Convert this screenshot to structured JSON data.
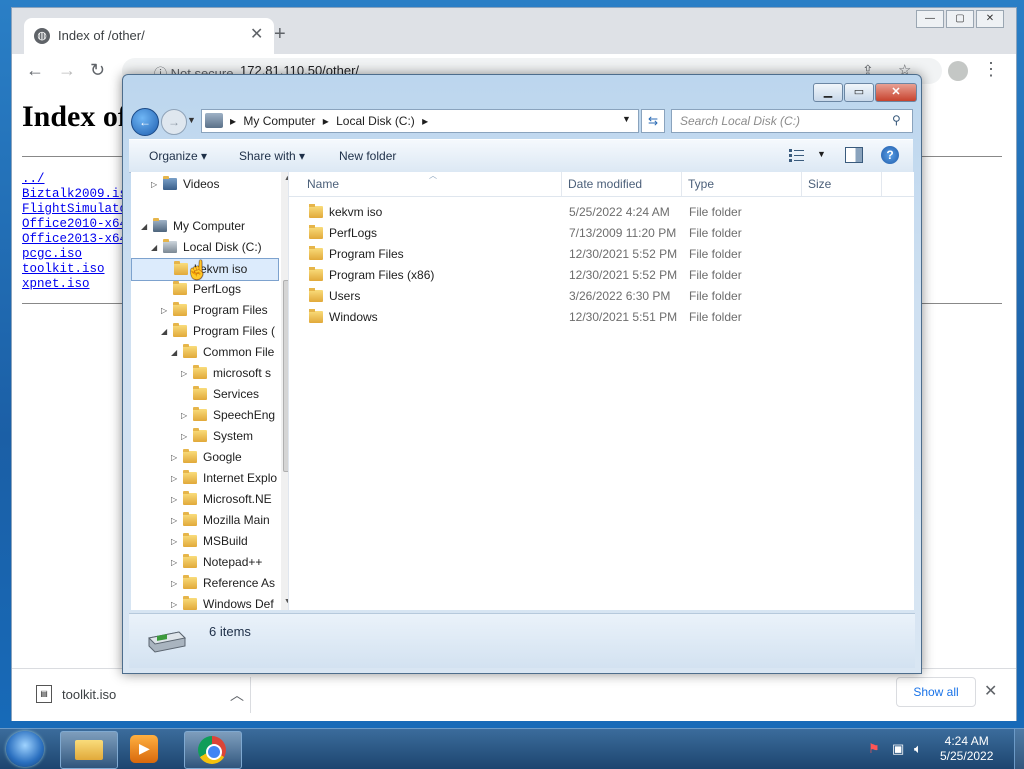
{
  "chrome": {
    "tab_title": "Index of /other/",
    "tab_close": "✕",
    "new_tab": "+",
    "omnibox_secure": "ⓘ Not secure",
    "omnibox_url": "172.81.110.50/other/",
    "window_minimize": "—",
    "window_maximize": "▢",
    "window_close": "✕"
  },
  "page": {
    "heading": "Index of /other/",
    "links": [
      "../",
      "Biztalk2009.iso",
      "FlightSimulator.iso",
      "Office2010-x64.iso",
      "Office2013-x64.iso",
      "pcgc.iso",
      "toolkit.iso",
      "xpnet.iso"
    ]
  },
  "downloads": {
    "file_name": "toolkit.iso",
    "show_all": "Show all",
    "chevron": "︿",
    "close": "✕"
  },
  "explorer": {
    "breadcrumbs": [
      "My Computer",
      "Local Disk (C:)"
    ],
    "search_placeholder": "Search Local Disk (C:)",
    "commands": {
      "organize": "Organize ▾",
      "share": "Share with ▾",
      "new_folder": "New folder"
    },
    "nav_tree": [
      {
        "label": "Videos",
        "indent": 1,
        "arrow": "▷",
        "icon": "video"
      },
      {
        "label": "My Computer",
        "indent": 0,
        "arrow": "◢",
        "icon": "computer"
      },
      {
        "label": "Local Disk (C:)",
        "indent": 1,
        "arrow": "◢",
        "icon": "drive"
      },
      {
        "label": "kekvm iso",
        "indent": 2,
        "arrow": "",
        "icon": "folder",
        "selected": true
      },
      {
        "label": "PerfLogs",
        "indent": 2,
        "arrow": "",
        "icon": "folder"
      },
      {
        "label": "Program Files",
        "indent": 2,
        "arrow": "▷",
        "icon": "folder"
      },
      {
        "label": "Program Files (",
        "indent": 2,
        "arrow": "◢",
        "icon": "folder"
      },
      {
        "label": "Common File",
        "indent": 3,
        "arrow": "◢",
        "icon": "folder"
      },
      {
        "label": "microsoft s",
        "indent": 4,
        "arrow": "▷",
        "icon": "folder"
      },
      {
        "label": "Services",
        "indent": 4,
        "arrow": "",
        "icon": "folder"
      },
      {
        "label": "SpeechEng",
        "indent": 4,
        "arrow": "▷",
        "icon": "folder"
      },
      {
        "label": "System",
        "indent": 4,
        "arrow": "▷",
        "icon": "folder"
      },
      {
        "label": "Google",
        "indent": 3,
        "arrow": "▷",
        "icon": "folder"
      },
      {
        "label": "Internet Explo",
        "indent": 3,
        "arrow": "▷",
        "icon": "folder"
      },
      {
        "label": "Microsoft.NE",
        "indent": 3,
        "arrow": "▷",
        "icon": "folder"
      },
      {
        "label": "Mozilla Main",
        "indent": 3,
        "arrow": "▷",
        "icon": "folder"
      },
      {
        "label": "MSBuild",
        "indent": 3,
        "arrow": "▷",
        "icon": "folder"
      },
      {
        "label": "Notepad++",
        "indent": 3,
        "arrow": "▷",
        "icon": "folder"
      },
      {
        "label": "Reference As",
        "indent": 3,
        "arrow": "▷",
        "icon": "folder"
      },
      {
        "label": "Windows Def",
        "indent": 3,
        "arrow": "▷",
        "icon": "folder"
      }
    ],
    "columns": [
      "Name",
      "Date modified",
      "Type",
      "Size"
    ],
    "files": [
      {
        "name": "kekvm iso",
        "date": "5/25/2022 4:24 AM",
        "type": "File folder",
        "size": ""
      },
      {
        "name": "PerfLogs",
        "date": "7/13/2009 11:20 PM",
        "type": "File folder",
        "size": ""
      },
      {
        "name": "Program Files",
        "date": "12/30/2021 5:52 PM",
        "type": "File folder",
        "size": ""
      },
      {
        "name": "Program Files (x86)",
        "date": "12/30/2021 5:52 PM",
        "type": "File folder",
        "size": ""
      },
      {
        "name": "Users",
        "date": "3/26/2022 6:30 PM",
        "type": "File folder",
        "size": ""
      },
      {
        "name": "Windows",
        "date": "12/30/2021 5:51 PM",
        "type": "File folder",
        "size": ""
      }
    ],
    "item_count": "6 items"
  },
  "taskbar": {
    "time": "4:24 AM",
    "date": "5/25/2022"
  }
}
